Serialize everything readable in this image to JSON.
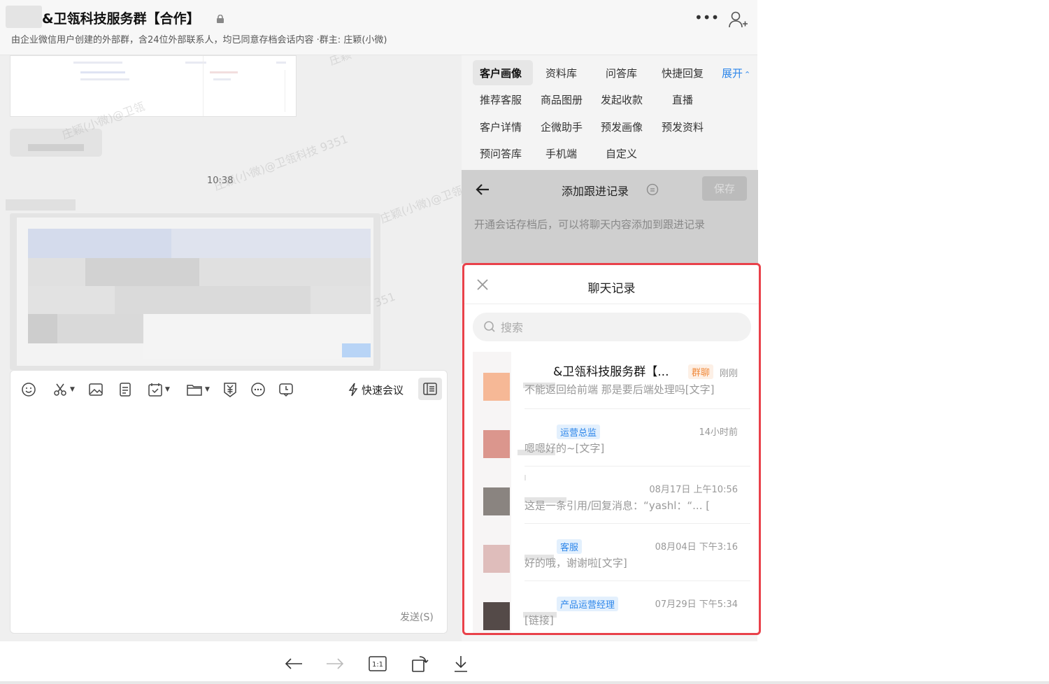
{
  "header": {
    "title": "&卫瓴科技服务群【合作】",
    "subtitle": "由企业微信用户创建的外部群，含24位外部联系人，均已同意存档会话内容 ·群主: 庄颖(小微)"
  },
  "chat": {
    "timestamp": "10:38",
    "watermark": "庄颖(小微)@卫瓴科技 9351"
  },
  "composer": {
    "quick_meeting_label": "快速会议",
    "send_label": "发送(S)"
  },
  "right_panel": {
    "tabs": [
      {
        "label": "客户画像"
      },
      {
        "label": "资料库"
      },
      {
        "label": "问答库"
      },
      {
        "label": "快捷回复"
      },
      {
        "label": "推荐客服"
      },
      {
        "label": "商品图册"
      },
      {
        "label": "发起收款"
      },
      {
        "label": "直播"
      },
      {
        "label": "客户详情"
      },
      {
        "label": "企微助手"
      },
      {
        "label": "预发画像"
      },
      {
        "label": "预发资料"
      },
      {
        "label": "预问答库"
      },
      {
        "label": "手机端"
      },
      {
        "label": "自定义"
      }
    ],
    "expand_label": "展开",
    "follow_up": {
      "title": "添加跟进记录",
      "save_label": "保存",
      "hint": "开通会话存档后，可以将聊天内容添加到跟进记录"
    }
  },
  "records_modal": {
    "title": "聊天记录",
    "search_placeholder": "搜索",
    "items": [
      {
        "name": "&卫瓴科技服务群【...",
        "tag": "群聊",
        "time": "刚刚",
        "message": "不能返回给前端 那是要后端处理吗[文字]",
        "avatar_color": "#f6b896"
      },
      {
        "name": "",
        "tag": "运营总监",
        "time": "14小时前",
        "message": "嗯嗯好的~[文字]",
        "avatar_color": "#db968d"
      },
      {
        "name": "",
        "tag": "",
        "time": "08月17日 上午10:56",
        "message": "这是一条引用/回复消息：“yashl：“...  [",
        "avatar_color": "#8a8480"
      },
      {
        "name": "",
        "tag": "客服",
        "time": "08月04日 下午3:16",
        "message": "好的哦，谢谢啦[文字]",
        "avatar_color": "#dfbdbb"
      },
      {
        "name": "",
        "tag": "产品运营经理",
        "time": "07月29日 下午5:34",
        "message": "[链接]",
        "avatar_color": "#544a48"
      }
    ]
  },
  "icons": {
    "composer_tools": [
      "emoji-icon",
      "scissors-icon",
      "image-icon",
      "document-icon",
      "task-icon",
      "folder-icon",
      "payment-icon",
      "more-dots-icon",
      "schedule-icon"
    ],
    "viewer": [
      "arrow-left-icon",
      "arrow-right-icon",
      "actual-size-icon",
      "rotate-icon",
      "download-icon"
    ]
  },
  "colors": {
    "modal_border": "#e9414a",
    "accent_blue": "#2d86ea",
    "group_tag": "#f08a3c"
  }
}
